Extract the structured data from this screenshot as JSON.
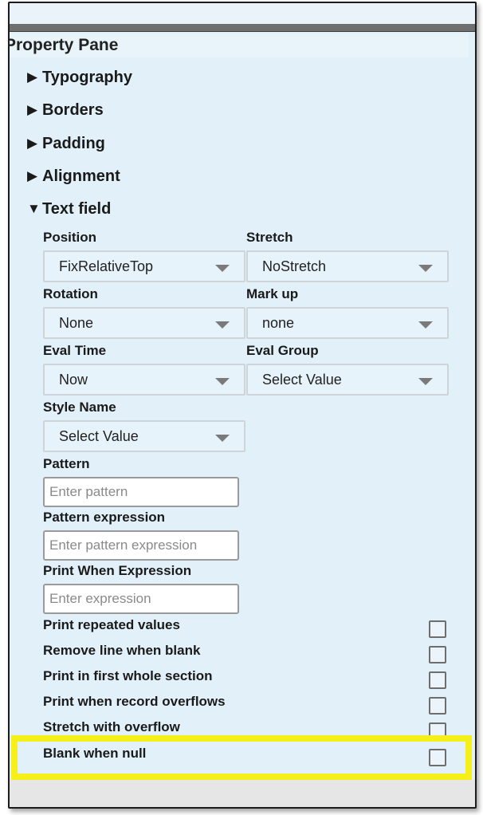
{
  "pane": {
    "title": "Property Pane"
  },
  "sections": [
    {
      "label": "Typography",
      "expanded": false
    },
    {
      "label": "Borders",
      "expanded": false
    },
    {
      "label": "Padding",
      "expanded": false
    },
    {
      "label": "Alignment",
      "expanded": false
    },
    {
      "label": "Text field",
      "expanded": true
    }
  ],
  "textfield": {
    "position": {
      "label": "Position",
      "value": "FixRelativeTop"
    },
    "stretch": {
      "label": "Stretch",
      "value": "NoStretch"
    },
    "rotation": {
      "label": "Rotation",
      "value": "None"
    },
    "markup": {
      "label": "Mark up",
      "value": "none"
    },
    "evaltime": {
      "label": "Eval Time",
      "value": "Now"
    },
    "evalgroup": {
      "label": "Eval Group",
      "value": "Select Value"
    },
    "stylename": {
      "label": "Style Name",
      "value": "Select Value"
    },
    "pattern": {
      "label": "Pattern",
      "placeholder": "Enter pattern"
    },
    "patternexpr": {
      "label": "Pattern expression",
      "placeholder": "Enter pattern expression"
    },
    "printwhen": {
      "label": "Print When Expression",
      "placeholder": "Enter expression"
    },
    "checkboxes": [
      {
        "label": "Print repeated values",
        "checked": false
      },
      {
        "label": "Remove line when blank",
        "checked": false
      },
      {
        "label": "Print in first whole section",
        "checked": false
      },
      {
        "label": "Print when record overflows",
        "checked": false
      },
      {
        "label": "Stretch with overflow",
        "checked": false
      },
      {
        "label": "Blank when null",
        "checked": false
      }
    ]
  },
  "colors": {
    "panel_bg": "#e2f1f9",
    "highlight": "#f6f01a",
    "topbar": "#6f6f6f"
  }
}
